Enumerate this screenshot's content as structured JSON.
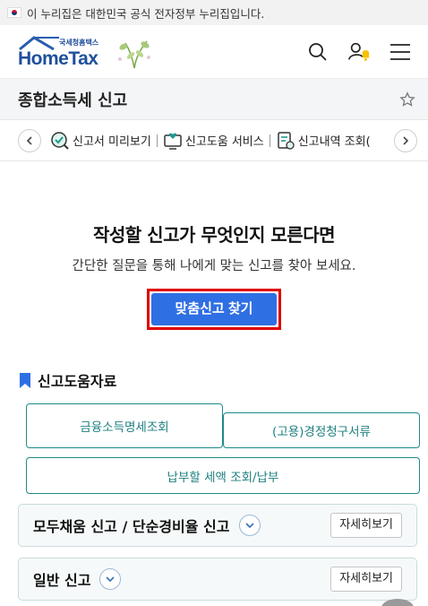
{
  "gov_banner": {
    "text": "이 누리집은 대한민국 공식 전자정부 누리집입니다."
  },
  "header": {
    "logo_sub": "국세청홈택스",
    "logo_text": "HomeTax",
    "icons": [
      "search-icon",
      "user-alert-icon",
      "menu-icon"
    ],
    "brand_color": "#1f4f9c"
  },
  "page": {
    "title": "종합소득세 신고"
  },
  "quick_nav": {
    "items": [
      {
        "label": "신고서 미리보기",
        "icon": "preview-check-icon"
      },
      {
        "label": "신고도움 서비스",
        "icon": "help-monitor-icon"
      },
      {
        "label": "신고내역 조회(",
        "icon": "history-doc-icon"
      }
    ]
  },
  "finder": {
    "title": "작성할 신고가 무엇인지 모른다면",
    "desc": "간단한 질문을 통해 나에게 맞는 신고를 찾아 보세요.",
    "button": "맞춤신고 찾기",
    "button_color": "#2f6fe4",
    "highlight_color": "#e00000"
  },
  "help": {
    "heading": "신고도움자료",
    "buttons": [
      "금융소득명세조회",
      "(고용)경정청구서류",
      "납부할 세액 조회/납부"
    ],
    "accent_color": "#1e8a8a"
  },
  "accordions": [
    {
      "title": "모두채움 신고 / 단순경비율 신고",
      "more": "자세히보기"
    },
    {
      "title": "일반 신고",
      "more": "자세히보기"
    }
  ]
}
